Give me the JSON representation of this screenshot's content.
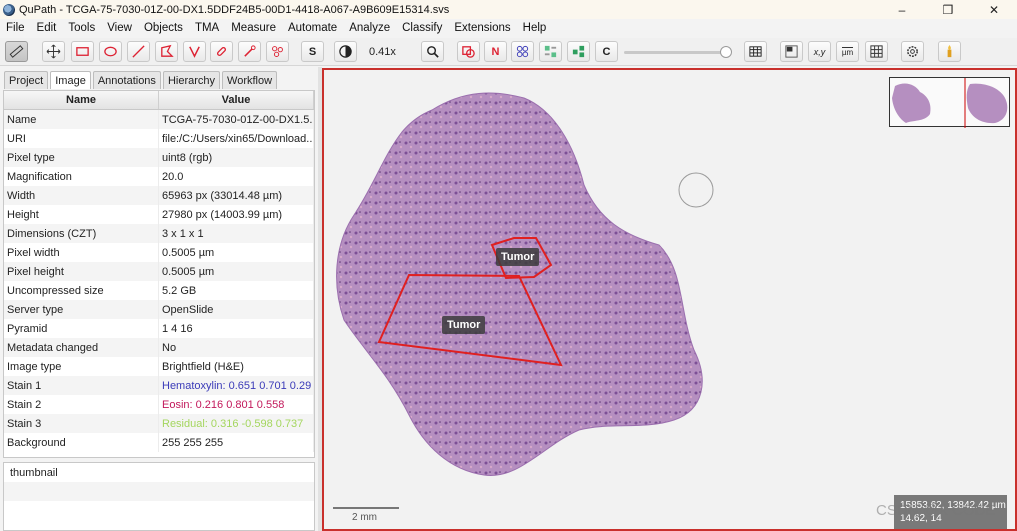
{
  "window": {
    "title": "QuPath - TCGA-75-7030-01Z-00-DX1.5DDF24B5-00D1-4418-A067-A9B609E15314.svs",
    "minimize": "–",
    "maximize": "❒",
    "close": "✕"
  },
  "menu": [
    "File",
    "Edit",
    "Tools",
    "View",
    "Objects",
    "TMA",
    "Measure",
    "Automate",
    "Analyze",
    "Classify",
    "Extensions",
    "Help"
  ],
  "toolbar": {
    "zoom": "0.41x",
    "selection_mode_label": "S",
    "show_names_label": "N",
    "show_classification_label": "C",
    "pixel_size_label": "µm",
    "coords_label": "x,y"
  },
  "tabs": [
    "Project",
    "Image",
    "Annotations",
    "Hierarchy",
    "Workflow"
  ],
  "active_tab": "Image",
  "table": {
    "headers": [
      "Name",
      "Value"
    ],
    "rows": [
      {
        "name": "Name",
        "value": "TCGA-75-7030-01Z-00-DX1.5..."
      },
      {
        "name": "URI",
        "value": "file:/C:/Users/xin65/Download..."
      },
      {
        "name": "Pixel type",
        "value": "uint8 (rgb)"
      },
      {
        "name": "Magnification",
        "value": "20.0"
      },
      {
        "name": "Width",
        "value": "65963 px (33014.48 µm)"
      },
      {
        "name": "Height",
        "value": "27980 px (14003.99 µm)"
      },
      {
        "name": "Dimensions (CZT)",
        "value": "3 x 1 x 1"
      },
      {
        "name": "Pixel width",
        "value": "0.5005 µm"
      },
      {
        "name": "Pixel height",
        "value": "0.5005 µm"
      },
      {
        "name": "Uncompressed size",
        "value": "5.2 GB"
      },
      {
        "name": "Server type",
        "value": "OpenSlide"
      },
      {
        "name": "Pyramid",
        "value": "1 4 16"
      },
      {
        "name": "Metadata changed",
        "value": "No"
      },
      {
        "name": "Image type",
        "value": "Brightfield (H&E)"
      },
      {
        "name": "Stain 1",
        "value": "Hematoxylin: 0.651 0.701 0.29",
        "color": "#3a3ab8"
      },
      {
        "name": "Stain 2",
        "value": "Eosin: 0.216 0.801 0.558",
        "color": "#c2185b"
      },
      {
        "name": "Stain 3",
        "value": "Residual: 0.316 -0.598 0.737",
        "color": "#a4d65e"
      },
      {
        "name": "Background",
        "value": "255 255 255"
      }
    ]
  },
  "associated_images": [
    "thumbnail"
  ],
  "viewer": {
    "annotations": [
      {
        "label": "Tumor",
        "color": "#e02020"
      },
      {
        "label": "Tumor",
        "color": "#e02020"
      }
    ],
    "scale_label": "2 mm",
    "coords_line1": "15853.62, 13842.42 µm",
    "coords_line2": "14.62, 14"
  },
  "watermark": "CSDN @X CODE"
}
